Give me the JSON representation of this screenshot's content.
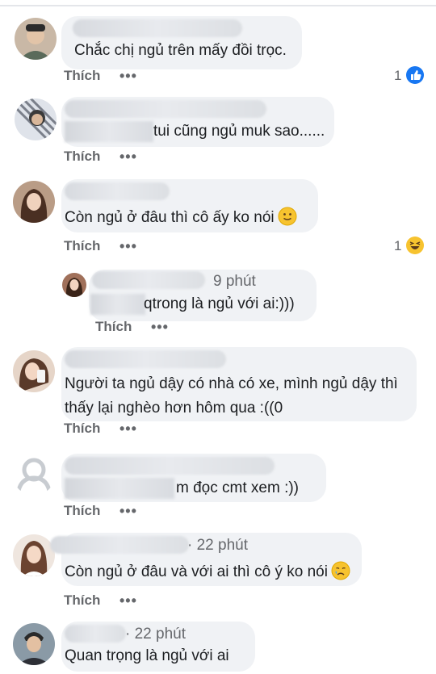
{
  "action_label": "Thích",
  "more_label": "•••",
  "colors": {
    "bubble": "#f0f2f5",
    "meta": "#65676b",
    "like_blue": "#1877f2",
    "haha_yellow": "#f7c32f"
  },
  "comments": [
    {
      "text": "Chắc chị ngủ trên mấy đồi trọc.",
      "reaction_count": "1",
      "reaction_icon": "like-icon"
    },
    {
      "text": "tui cũng ngủ muk sao......"
    },
    {
      "text": "Còn ngủ ở đâu thì cô ấy ko nói",
      "emoji": "slight-smile-emoji",
      "reaction_count": "1",
      "reaction_icon": "haha-icon",
      "reply": {
        "time": "9 phút",
        "text": "qtrong là ngủ với ai:)))"
      }
    },
    {
      "lines": [
        "Người ta ngủ dậy có nhà có xe, mình ngủ dậy thì",
        "thấy lại nghèo hơn hôm qua :((0"
      ]
    },
    {
      "text": "m đọc cmt xem :))"
    },
    {
      "time": "· 22 phút",
      "text": "Còn ngủ ở đâu và với ai thì cô ý ko nói",
      "emoji": "sad-tear-emoji"
    },
    {
      "time": "· 22 phút",
      "text": "Quan trọng là ngủ với ai"
    }
  ]
}
